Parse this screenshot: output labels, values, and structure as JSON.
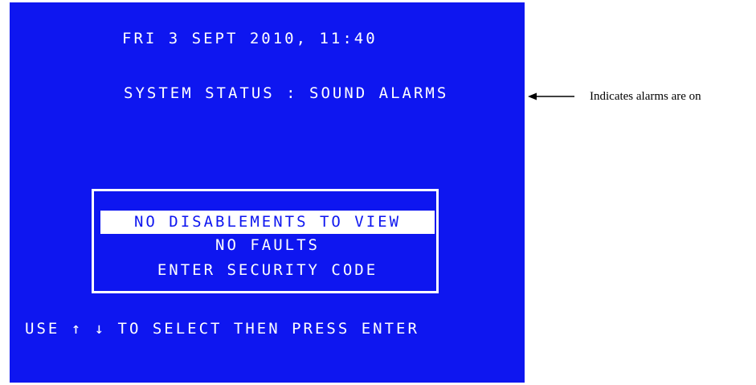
{
  "panel": {
    "datetime": "FRI 3 SEPT 2010, 11:40",
    "system_status": "SYSTEM STATUS : SOUND ALARMS",
    "menu": {
      "items": [
        {
          "label": "NO DISABLEMENTS TO VIEW",
          "selected": true
        },
        {
          "label": "NO FAULTS",
          "selected": false
        },
        {
          "label": "ENTER SECURITY CODE",
          "selected": false
        }
      ]
    },
    "instruction": "USE ↑ ↓ TO SELECT THEN PRESS ENTER"
  },
  "annotation": {
    "arrow_icon": "arrow-left-icon",
    "text": "Indicates alarms are on"
  },
  "colors": {
    "screen_background": "#0e16f0",
    "screen_text": "#ffffff",
    "page_background": "#ffffff"
  }
}
